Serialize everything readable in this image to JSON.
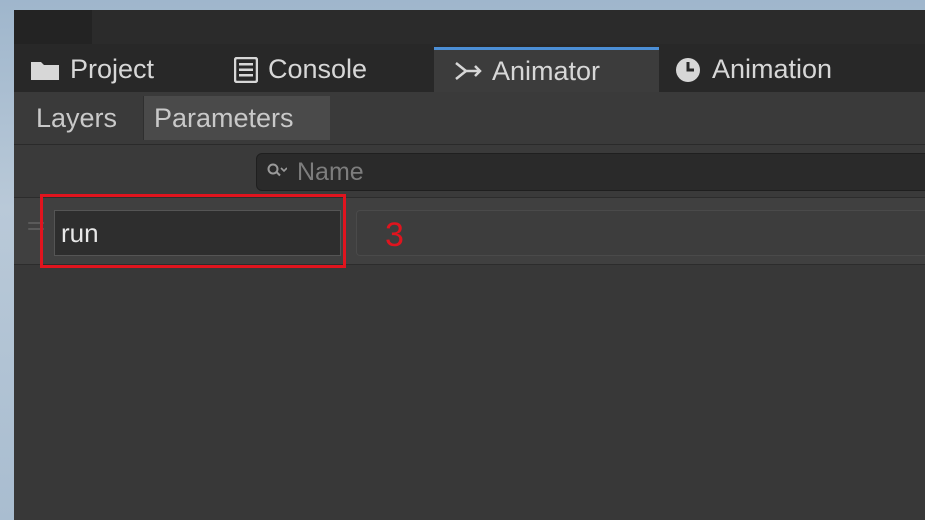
{
  "tabs": [
    {
      "label": "Project",
      "icon": "folder-icon"
    },
    {
      "label": "Console",
      "icon": "console-icon"
    },
    {
      "label": "Animator",
      "icon": "animator-icon",
      "active": true
    },
    {
      "label": "Animation",
      "icon": "clock-icon"
    }
  ],
  "subtabs": {
    "layers": "Layers",
    "parameters": "Parameters",
    "selected": "Parameters"
  },
  "search": {
    "placeholder": "Name",
    "value": ""
  },
  "parameter_row": {
    "name_value": "run"
  },
  "annotation": {
    "step_number": "3",
    "color": "#e0141e"
  },
  "colors": {
    "accent": "#4c8fd6",
    "panel": "#383838",
    "tabbar": "#282828"
  }
}
